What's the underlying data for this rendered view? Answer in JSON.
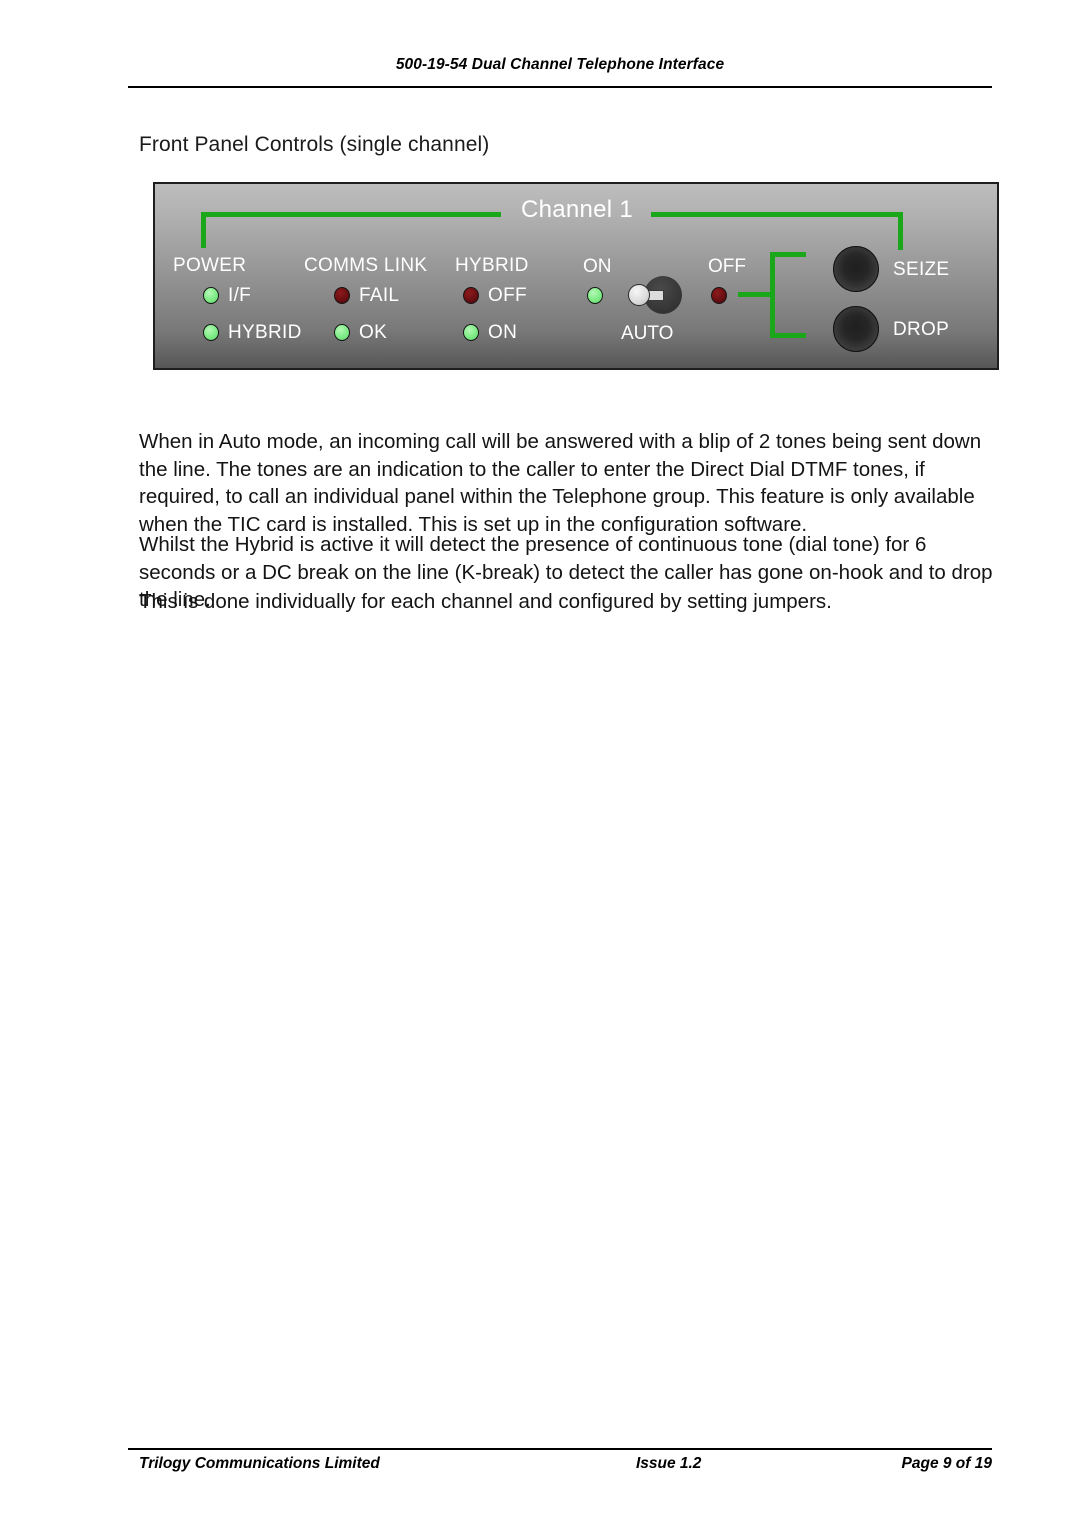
{
  "document": {
    "header_title": "500-19-54 Dual Channel Telephone Interface",
    "section_caption": "Front Panel Controls (single channel)"
  },
  "panel": {
    "channel_title": "Channel 1",
    "accent_color": "#1aa81a",
    "led_green_color": "#86ef8d",
    "led_red_color": "#6b0f12",
    "groups": [
      {
        "title": "POWER",
        "leds": [
          {
            "label": "I/F",
            "state": "green"
          },
          {
            "label": "HYBRID",
            "state": "green"
          }
        ]
      },
      {
        "title": "COMMS LINK",
        "leds": [
          {
            "label": "FAIL",
            "state": "red"
          },
          {
            "label": "OK",
            "state": "green"
          }
        ]
      },
      {
        "title": "HYBRID",
        "leds": [
          {
            "label": "OFF",
            "state": "red"
          },
          {
            "label": "ON",
            "state": "green"
          }
        ]
      }
    ],
    "switch": {
      "on_label": "ON",
      "off_label": "OFF",
      "auto_label": "AUTO",
      "on_led_state": "green",
      "off_led_state": "red",
      "position": "on"
    },
    "buttons": [
      {
        "label": "SEIZE"
      },
      {
        "label": "DROP"
      }
    ]
  },
  "body": {
    "paragraph_1": "When in Auto mode, an incoming call will be answered with a blip of 2 tones being sent down the line. The tones are an indication to the caller to enter the Direct Dial DTMF tones, if required, to call an individual panel within the Telephone group. This feature is only available when the TIC card is installed. This is set up in the configuration software.",
    "paragraph_2": "Whilst the Hybrid is active it will detect the presence of continuous tone (dial tone) for 6 seconds or a DC break on the line (K-break) to detect the caller has gone on-hook and to drop the line.",
    "paragraph_3": "This is done individually for each channel and configured by setting jumpers."
  },
  "footer": {
    "left": "Trilogy Communications Limited",
    "middle": "Issue 1.2",
    "right": "Page 9 of 19"
  }
}
